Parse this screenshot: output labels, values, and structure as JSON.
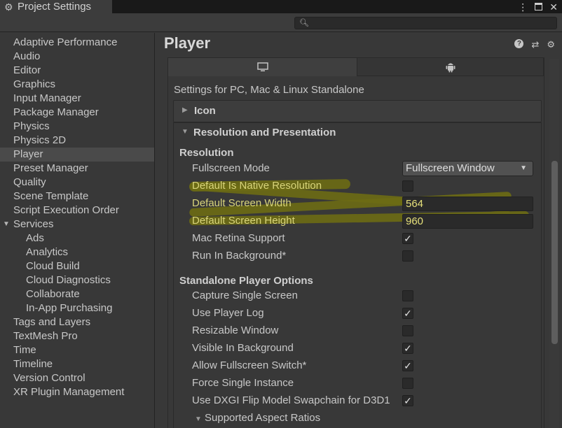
{
  "window": {
    "title": "Project Settings",
    "controls": [
      "⋮",
      "maximize",
      "✕"
    ]
  },
  "search": {
    "placeholder": ""
  },
  "sidebar": {
    "items": [
      {
        "label": "Adaptive Performance"
      },
      {
        "label": "Audio"
      },
      {
        "label": "Editor"
      },
      {
        "label": "Graphics"
      },
      {
        "label": "Input Manager"
      },
      {
        "label": "Package Manager"
      },
      {
        "label": "Physics"
      },
      {
        "label": "Physics 2D"
      },
      {
        "label": "Player",
        "active": true
      },
      {
        "label": "Preset Manager"
      },
      {
        "label": "Quality"
      },
      {
        "label": "Scene Template"
      },
      {
        "label": "Script Execution Order"
      },
      {
        "label": "Services",
        "expanded": true
      },
      {
        "label": "Ads",
        "child": true
      },
      {
        "label": "Analytics",
        "child": true
      },
      {
        "label": "Cloud Build",
        "child": true
      },
      {
        "label": "Cloud Diagnostics",
        "child": true
      },
      {
        "label": "Collaborate",
        "child": true
      },
      {
        "label": "In-App Purchasing",
        "child": true
      },
      {
        "label": "Tags and Layers"
      },
      {
        "label": "TextMesh Pro"
      },
      {
        "label": "Time"
      },
      {
        "label": "Timeline"
      },
      {
        "label": "Version Control"
      },
      {
        "label": "XR Plugin Management"
      }
    ]
  },
  "main": {
    "title": "Player",
    "platform_tabs": [
      {
        "icon": "monitor-icon",
        "active": true
      },
      {
        "icon": "android-icon",
        "active": false
      }
    ],
    "settings_for": "Settings for PC, Mac & Linux Standalone",
    "icon_section": "Icon",
    "resolution_section": "Resolution and Presentation",
    "resolution_subhead": "Resolution",
    "fullscreen_mode": {
      "label": "Fullscreen Mode",
      "value": "Fullscreen Window"
    },
    "native_resolution": {
      "label": "Default Is Native Resolution",
      "checked": false
    },
    "screen_width": {
      "label": "Default Screen Width",
      "value": "564"
    },
    "screen_height": {
      "label": "Default Screen Height",
      "value": "960"
    },
    "mac_retina": {
      "label": "Mac Retina Support",
      "checked": true
    },
    "run_in_background": {
      "label": "Run In Background*",
      "checked": false
    },
    "standalone_subhead": "Standalone Player Options",
    "capture_single_screen": {
      "label": "Capture Single Screen",
      "checked": false
    },
    "use_player_log": {
      "label": "Use Player Log",
      "checked": true
    },
    "resizable_window": {
      "label": "Resizable Window",
      "checked": false
    },
    "visible_in_background": {
      "label": "Visible In Background",
      "checked": true
    },
    "allow_fullscreen_switch": {
      "label": "Allow Fullscreen Switch*",
      "checked": true
    },
    "force_single_instance": {
      "label": "Force Single Instance",
      "checked": false
    },
    "use_dxgi": {
      "label": "Use DXGI Flip Model Swapchain for D3D1",
      "checked": true
    },
    "aspect_ratios": "Supported Aspect Ratios",
    "check_glyph": "✓"
  },
  "colors": {
    "background": "#383838",
    "highlight_scribble": "#6d6b14",
    "highlight_text": "#d8d47a"
  }
}
